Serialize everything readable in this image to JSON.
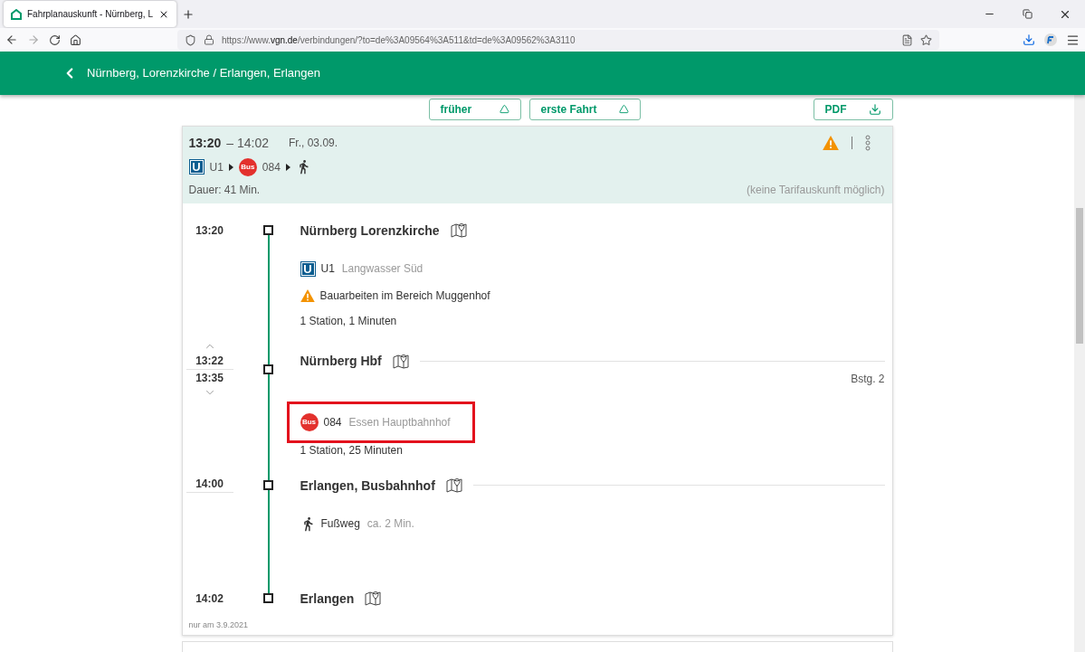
{
  "browser": {
    "tab": {
      "title": "Fahrplanauskunft - Nürnberg, L",
      "selected": true
    },
    "url_prefix": "https://www.",
    "url_domain": "vgn.de",
    "url_path": "/verbindungen/?to=de%3A09564%3A511&td=de%3A09562%3A3110"
  },
  "header": {
    "title": "Nürnberg, Lorenzkirche / Erlangen, Erlangen"
  },
  "actions": [
    {
      "label": "früher",
      "kind": "up"
    },
    {
      "label": "erste Fahrt",
      "kind": "up"
    },
    {
      "label": "PDF",
      "kind": "download"
    }
  ],
  "connection": {
    "depart": "13:20",
    "arrive": "– 14:02",
    "date": "Fr., 03.09.",
    "warning": true,
    "summary": [
      {
        "kind": "subway",
        "badge": "U",
        "line": "U1"
      },
      {
        "kind": "bus",
        "badge": "Bus",
        "line": "084"
      },
      {
        "kind": "walk"
      }
    ],
    "duration": "Dauer: 41 Min.",
    "fare_note": "(keine Tarifauskunft möglich)",
    "stops": [
      {
        "name": "Nürnberg Lorenzkirche",
        "times": [
          "13:20"
        ],
        "leg": {
          "kind": "subway",
          "badge": "U",
          "line": "U1",
          "direction": "Langwasser Süd",
          "highlighted": false,
          "notice": "Bauarbeiten im Bereich Muggenhof",
          "info": "1 Station, 1 Minuten"
        }
      },
      {
        "name": "Nürnberg Hbf",
        "times": [
          "13:22",
          "13:35"
        ],
        "platform": "Bstg. 2",
        "leg": {
          "kind": "bus",
          "badge": "Bus",
          "line": "084",
          "direction": "Essen Hauptbahnhof",
          "highlighted": true,
          "info": "1 Station, 25 Minuten"
        }
      },
      {
        "name": "Erlangen, Busbahnhof",
        "times": [
          "14:00"
        ],
        "leg": {
          "kind": "walk",
          "line": "Fußweg",
          "direction": "ca. 2 Min.",
          "highlighted": false
        }
      },
      {
        "name": "Erlangen",
        "times": [
          "14:02"
        ]
      }
    ],
    "note": "nur am 3.9.2021"
  }
}
